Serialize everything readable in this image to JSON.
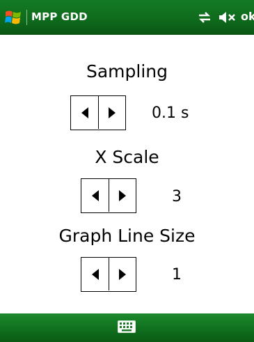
{
  "window": {
    "title": "MPP GDD",
    "ok_label": "ok"
  },
  "settings": [
    {
      "label": "Sampling",
      "value": "0.1 s"
    },
    {
      "label": "X Scale",
      "value": "3"
    },
    {
      "label": "Graph Line Size",
      "value": "1"
    }
  ],
  "icons": {
    "start": "windows-start-icon",
    "connectivity": "connectivity-icon",
    "volume": "volume-muted-icon",
    "keyboard": "keyboard-icon",
    "decrement": "left-arrow-icon",
    "increment": "right-arrow-icon"
  },
  "colors": {
    "bar_green": "#137a24",
    "text": "#000000",
    "background": "#ffffff"
  }
}
